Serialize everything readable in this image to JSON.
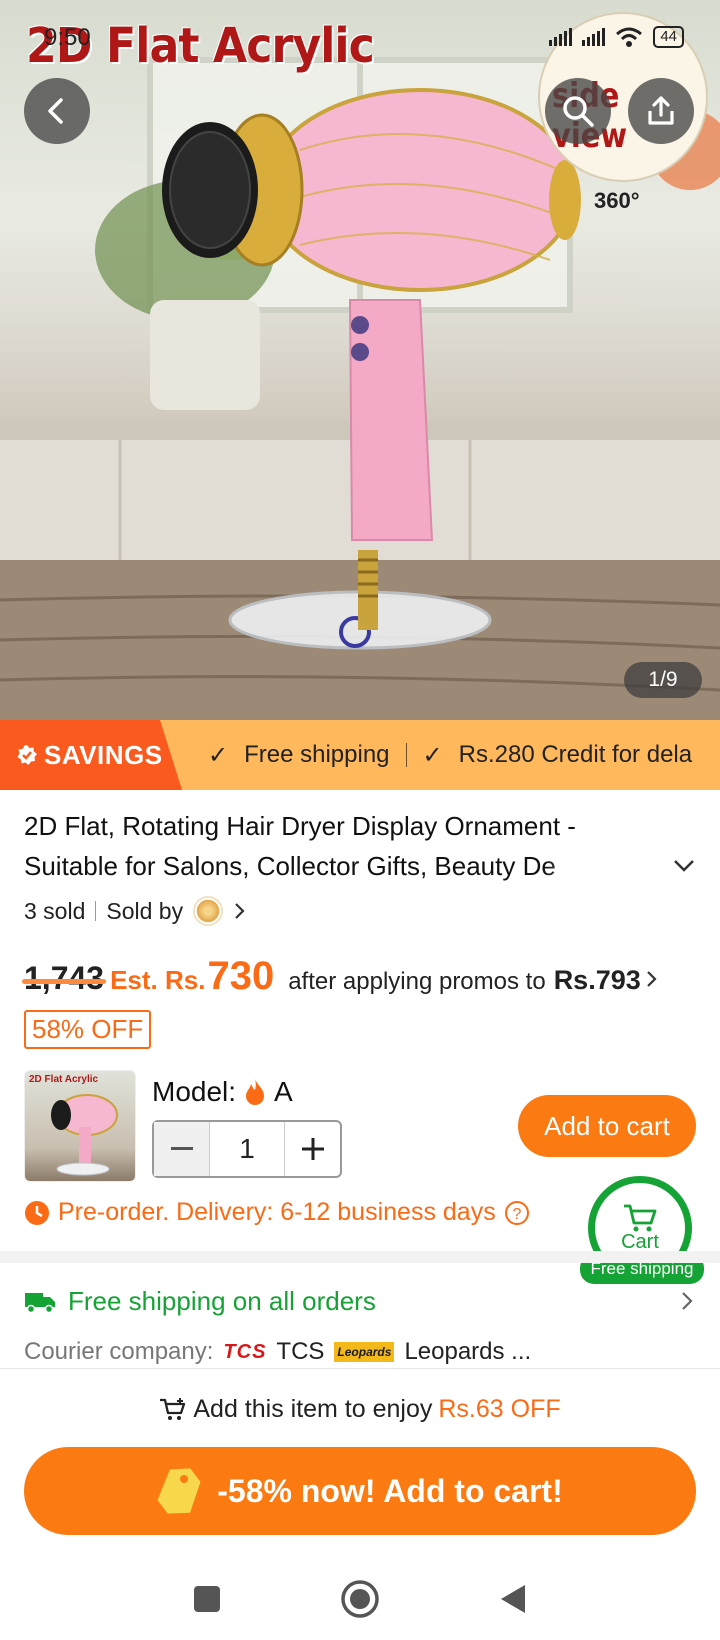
{
  "status_bar": {
    "time": "9:50",
    "battery": "44"
  },
  "hero": {
    "image_title": "2D Flat Acrylic",
    "side_view_label": "side view",
    "badge_360": "360°",
    "pager": "1/9"
  },
  "savings_bar": {
    "tag": "SAVINGS",
    "items": [
      "Free shipping",
      "Rs.280 Credit for dela"
    ]
  },
  "product": {
    "title": "2D Flat, Rotating Hair Dryer Display Ornament - Suitable for Salons, Collector Gifts, Beauty De",
    "sold": "3 sold",
    "sold_by": "Sold by"
  },
  "price": {
    "original": "1,743",
    "est_prefix": "Est. Rs.",
    "est_value": "730",
    "after_text": "after applying promos to",
    "promo_price": "Rs.793",
    "discount_badge": "58% OFF"
  },
  "model": {
    "label": "Model:",
    "value": "A",
    "thumb_text": "2D Flat Acrylic",
    "quantity": "1",
    "add_to_cart": "Add to cart"
  },
  "delivery": {
    "preorder": "Pre-order. Delivery: 6-12 business days"
  },
  "floating_cart": {
    "label": "Cart",
    "badge": "Free shipping"
  },
  "shipping": {
    "headline": "Free shipping on all orders",
    "courier_label": "Courier company:",
    "couriers": [
      "TCS",
      "Leopards ..."
    ],
    "tcs_logo": "TCS",
    "leopards_logo": "Leopards"
  },
  "bottom": {
    "enjoy_prefix": "Add this item to enjoy",
    "enjoy_amount": "Rs.63 OFF",
    "cta": "-58% now! Add to cart!"
  },
  "colors": {
    "accent": "#fb7a12",
    "green": "#16a336",
    "savings_tag": "#fb5a1e",
    "savings_bar": "#ffb85c"
  }
}
